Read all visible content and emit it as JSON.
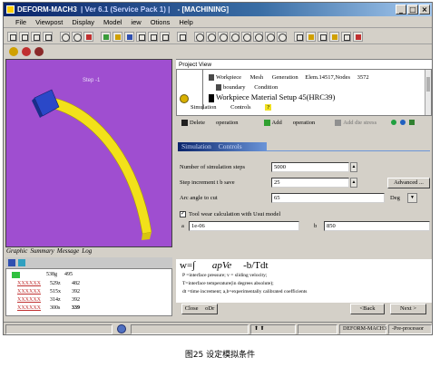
{
  "window": {
    "title_app": "DEFORM-MACH3",
    "title_version": "| Ver 6.1 (Service Pack 1) |",
    "title_mode": "- [MACHINING]",
    "buttons": {
      "min": "_",
      "max": "□",
      "close": "×"
    }
  },
  "menu": [
    "File",
    "Viewpost",
    "Display",
    "Model",
    "iew",
    "Otions",
    "Help"
  ],
  "viewport": {
    "step_label": "Step -1",
    "tabs": [
      "Graphic",
      "Summary",
      "Message",
      "Log"
    ]
  },
  "left_list": {
    "rows": [
      {
        "name": "",
        "a": "538g",
        "b": "495"
      },
      {
        "name": "XXXXXX",
        "a": "529z",
        "b": "482"
      },
      {
        "name": "XXXXXX",
        "a": "515x",
        "b": "392"
      },
      {
        "name": "XXXXXX",
        "a": "314z",
        "b": "392"
      },
      {
        "name": "XXXXXX",
        "a": "300s",
        "b": "339"
      }
    ]
  },
  "project_view": {
    "label": "Project View",
    "nodes": {
      "workpiece": "Workpiece",
      "mesh": "Mesh",
      "generation": "Generation",
      "elem": "Elem.14517,Nodes",
      "elem_num": "3572",
      "boundary": "boundary",
      "condition": "Condition",
      "material": "Workpiece Material Setup 45(HRC39)",
      "simulation": "Simulation",
      "controls": "Controls",
      "badge": "?"
    },
    "actions": {
      "delete": "Delete",
      "delete_2": "operation",
      "add": "Add",
      "add_2": "operation",
      "add_die": "Add die stress"
    }
  },
  "sim_controls": {
    "title": "Simulation",
    "title_2": "Controls",
    "num_steps_label": "Number of simulation steps",
    "num_steps": "5000",
    "step_inc_label": "Step increment t b save",
    "step_inc": "25",
    "advanced": "Advanced ...",
    "arc_label": "Arc angle to cut",
    "arc_value": "65",
    "arc_unit": "Deg",
    "tool_wear_label": "Tool wear calculation with Usui model",
    "a_label": "a",
    "a_value": "1e-06",
    "b_label": "b",
    "b_value": "850",
    "formula_main": "w=∫",
    "formula_mid": "apVe",
    "formula_end": "-b/Tdt",
    "legend_1": "P =interface pressure; v = sliding velocity;",
    "legend_2": "T=interface temperature(in degrees absolute);",
    "legend_3": "dt =time increment; a,b=experimentally calibrated coefficients",
    "close": "Close",
    "close_2": "oDr",
    "back": "<Back",
    "next": "Next >"
  },
  "status": {
    "arrows": "⬆ ⬆",
    "app": "DEFORM-MACH3",
    "mode": "-Pre-processor"
  },
  "caption": "图25  设定模拟条件",
  "colors": {
    "viewport_bg": "#9f4ed0",
    "workpiece": "#f2e11a",
    "tool": "#2a48c8",
    "title_grad": "#0a246a"
  }
}
